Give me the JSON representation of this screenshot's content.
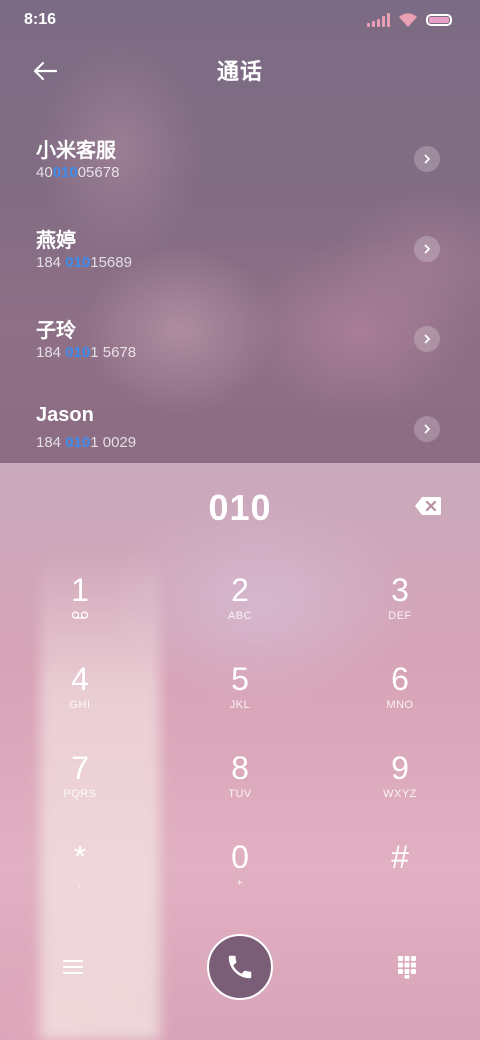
{
  "status": {
    "time": "8:16",
    "signal_color": "#e9a0b2",
    "battery_color": "#e9a0c8"
  },
  "header": {
    "title": "通话",
    "back_icon": "arrow-left-icon"
  },
  "contacts": [
    {
      "name": "小米客服",
      "number_pre": "40",
      "number_hl": "010",
      "number_post": "05678"
    },
    {
      "name": "燕婷",
      "number_pre": "184 ",
      "number_hl": "010",
      "number_post": "15689"
    },
    {
      "name": "子玲",
      "number_pre": "184 ",
      "number_hl": "010",
      "number_post": "1 5678"
    },
    {
      "name": "Jason",
      "number_pre": "184 ",
      "number_hl": "010",
      "number_post": "1 0029"
    }
  ],
  "dialer": {
    "entered_number": "010",
    "highlight_color": "#3b8ef0",
    "keys": [
      {
        "digit": "1",
        "letters": ""
      },
      {
        "digit": "2",
        "letters": "ABC"
      },
      {
        "digit": "3",
        "letters": "DEF"
      },
      {
        "digit": "4",
        "letters": "GHI"
      },
      {
        "digit": "5",
        "letters": "JKL"
      },
      {
        "digit": "6",
        "letters": "MNO"
      },
      {
        "digit": "7",
        "letters": "PQRS"
      },
      {
        "digit": "8",
        "letters": "TUV"
      },
      {
        "digit": "9",
        "letters": "WXYZ"
      },
      {
        "digit": "*",
        "letters": ","
      },
      {
        "digit": "0",
        "letters": "+"
      },
      {
        "digit": "#",
        "letters": ""
      }
    ],
    "key1_icon": "voicemail-icon",
    "call_button_color": "#7a5e77"
  }
}
